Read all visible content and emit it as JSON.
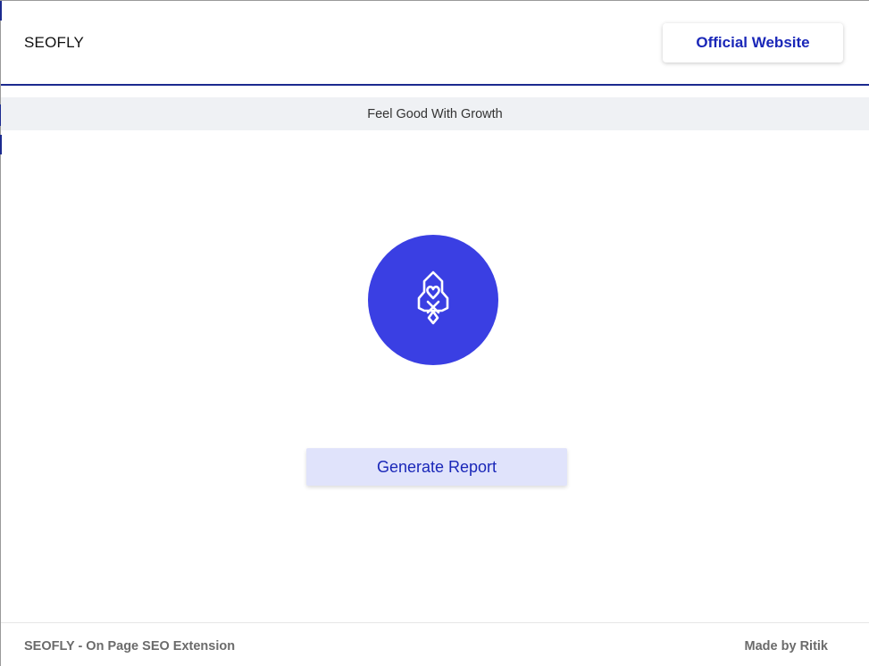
{
  "header": {
    "brand": "SEOFLY",
    "official_website_label": "Official Website"
  },
  "tagline": "Feel Good With Growth",
  "main": {
    "logo_icon": "rocket-heart-icon",
    "generate_label": "Generate Report"
  },
  "footer": {
    "left_text": "SEOFLY - On Page SEO Extension",
    "right_text": "Made by Ritik"
  },
  "colors": {
    "accent": "#3a3fe3",
    "link_blue": "#1a27b8",
    "header_rule": "#1b2a8f",
    "tagline_bg": "#eff1f4",
    "generate_bg": "#e0e3fb"
  }
}
